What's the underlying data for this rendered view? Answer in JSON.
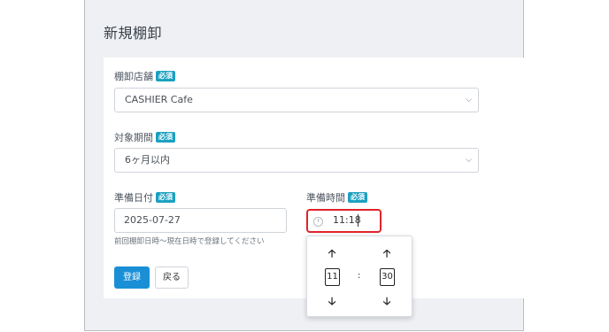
{
  "page": {
    "title": "新規棚卸"
  },
  "form": {
    "required_badge": "必須",
    "store": {
      "label": "棚卸店舗",
      "value": "CASHIER Cafe"
    },
    "period": {
      "label": "対象期間",
      "value": "6ヶ月以内"
    },
    "prep_date": {
      "label": "準備日付",
      "value": "2025-07-27",
      "help": "前回棚卸日時〜現在日時で登録してください"
    },
    "prep_time": {
      "label": "準備時間",
      "value": "11:18"
    }
  },
  "time_picker": {
    "hour": "11",
    "separator": ":",
    "minute": "30"
  },
  "buttons": {
    "submit": "登録",
    "back": "戻る"
  },
  "colors": {
    "accent": "#1a8fd6",
    "badge": "#1ba0c0",
    "highlight": "#e0242b"
  }
}
